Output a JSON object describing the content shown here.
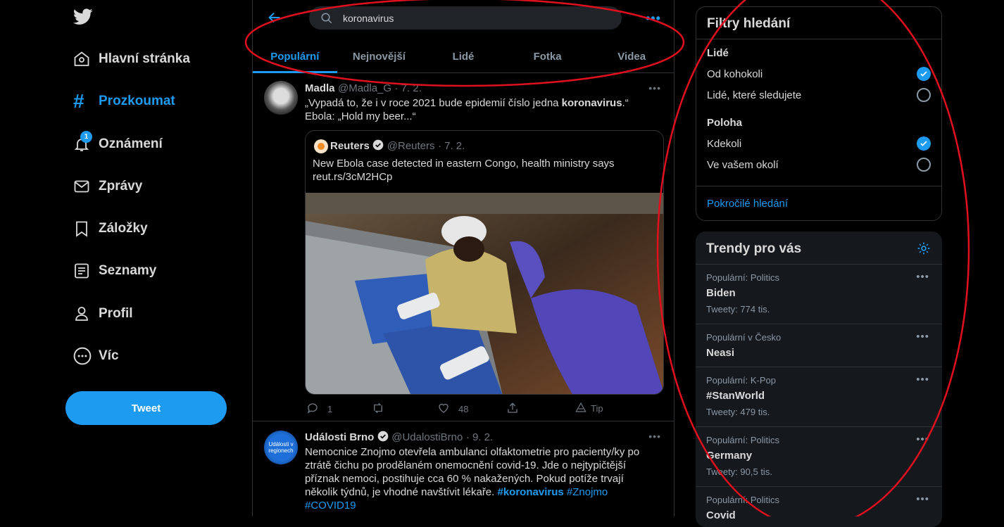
{
  "nav": {
    "items": [
      {
        "label": "Hlavní stránka"
      },
      {
        "label": "Prozkoumat"
      },
      {
        "label": "Oznámení"
      },
      {
        "label": "Zprávy"
      },
      {
        "label": "Záložky"
      },
      {
        "label": "Seznamy"
      },
      {
        "label": "Profil"
      },
      {
        "label": "Víc"
      }
    ],
    "notification_badge": "1",
    "tweet_button": "Tweet"
  },
  "search": {
    "value": "koronavirus"
  },
  "tabs": [
    "Populární",
    "Nejnovější",
    "Lidé",
    "Fotka",
    "Videa"
  ],
  "tweets": [
    {
      "name": "Madla",
      "handle": "@Madla_G",
      "date": "· 7. 2.",
      "text_before": "„Vypadá to, že i v roce 2021 bude epidemií číslo jedna ",
      "text_bold": "koronavirus",
      "text_after": ".“",
      "text_line2": "Ebola: „Hold my beer...“",
      "quote": {
        "name": "Reuters",
        "handle": "@Reuters",
        "date": "· 7. 2.",
        "text": "New Ebola case detected in eastern Congo, health ministry says",
        "link": "reut.rs/3cM2HCp"
      },
      "replies": "1",
      "retweets": "",
      "likes": "48",
      "tip": "Tip"
    },
    {
      "name": "Události Brno",
      "handle": "@UdalostiBrno",
      "date": "· 9. 2.",
      "text": "Nemocnice Znojmo otevřela ambulanci olfaktometrie pro pacienty/ky po ztrátě čichu po prodělaném onemocnění covid-19. Jde o nejtypičtější příznak nemoci, postihuje cca 60 % nakažených. Pokud potíže trvají několik týdnů, je vhodné navštívit lékaře. ",
      "hashtag1": "#koronavirus",
      "hashtag2": " #Znojmo",
      "hashtag3": "#COVID19",
      "avatar_text": "Události v regionech"
    }
  ],
  "filters": {
    "title": "Filtry hledání",
    "people_heading": "Lidé",
    "people_options": [
      {
        "label": "Od kohokoli",
        "checked": true
      },
      {
        "label": "Lidé, které sledujete",
        "checked": false
      }
    ],
    "location_heading": "Poloha",
    "location_options": [
      {
        "label": "Kdekoli",
        "checked": true
      },
      {
        "label": "Ve vašem okolí",
        "checked": false
      }
    ],
    "advanced_link": "Pokročilé hledání"
  },
  "trends": {
    "title": "Trendy pro vás",
    "items": [
      {
        "category": "Populární: Politics",
        "name": "Biden",
        "count": "Tweety: 774 tis."
      },
      {
        "category": "Populární v Česko",
        "name": "Neasi",
        "count": ""
      },
      {
        "category": "Populární: K-Pop",
        "name": "#StanWorld",
        "count": "Tweety: 479 tis."
      },
      {
        "category": "Populární: Politics",
        "name": "Germany",
        "count": "Tweety: 90,5 tis."
      },
      {
        "category": "Populární: Politics",
        "name": "Covid",
        "count": ""
      }
    ]
  },
  "colors": {
    "accent": "#1d9bf0",
    "annotation": "#e0101e"
  }
}
